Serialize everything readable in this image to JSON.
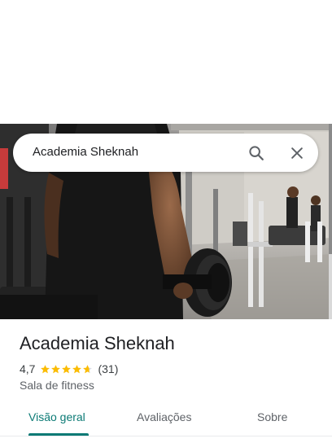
{
  "search": {
    "query": "Academia Sheknah",
    "search_icon": "search-icon",
    "close_icon": "close-icon"
  },
  "hero": {
    "photo": "gym-photo"
  },
  "place": {
    "title": "Academia Sheknah",
    "rating": "4,7",
    "stars": 4.7,
    "review_count": "(31)",
    "category": "Sala de fitness"
  },
  "tabs": [
    {
      "label": "Visão geral",
      "active": true
    },
    {
      "label": "Avaliações",
      "active": false
    },
    {
      "label": "Sobre",
      "active": false
    }
  ],
  "colors": {
    "accent": "#0b7a75",
    "star": "#fbbc04",
    "star_empty": "#dadce0"
  }
}
